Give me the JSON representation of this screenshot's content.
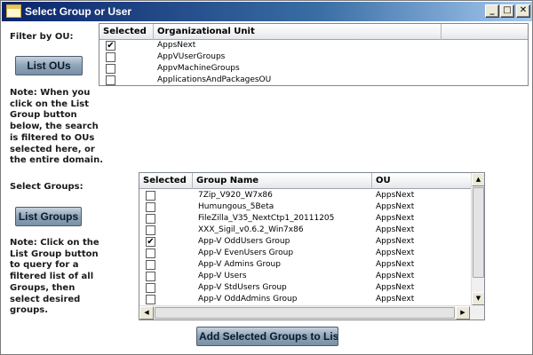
{
  "window": {
    "title": "Select Group or User",
    "minimize_glyph": "_",
    "maximize_glyph": "□",
    "close_glyph": "✕"
  },
  "filter": {
    "label": "Filter by OU:",
    "list_ous_button": "List OUs",
    "note_lines": [
      "Note: When you",
      "click on the List",
      "Group button",
      "below, the search",
      "is filtered to OUs",
      "selected here, or",
      "the entire domain."
    ]
  },
  "ou_grid": {
    "headers": [
      "Selected",
      "Organizational Unit",
      ""
    ],
    "rows": [
      {
        "selected": true,
        "name": "AppsNext"
      },
      {
        "selected": false,
        "name": "AppVUserGroups"
      },
      {
        "selected": false,
        "name": "AppvMachineGroups"
      },
      {
        "selected": false,
        "name": "ApplicationsAndPackagesOU"
      }
    ]
  },
  "groups": {
    "label": "Select Groups:",
    "list_groups_button": "List Groups",
    "note_lines": [
      "Note: Click on the",
      "List Group button",
      "to query for a",
      "filtered list of all",
      "Groups, then",
      "select desired",
      "groups."
    ]
  },
  "group_grid": {
    "headers": [
      "Selected",
      "Group Name",
      "OU"
    ],
    "rows": [
      {
        "selected": false,
        "name": "7Zip_V920_W7x86",
        "ou": "AppsNext"
      },
      {
        "selected": false,
        "name": "Humungous_5Beta",
        "ou": "AppsNext"
      },
      {
        "selected": false,
        "name": "FileZilla_V35_NextCtp1_20111205",
        "ou": "AppsNext"
      },
      {
        "selected": false,
        "name": "XXX_Sigil_v0.6.2_Win7x86",
        "ou": "AppsNext"
      },
      {
        "selected": true,
        "name": "App-V OddUsers Group",
        "ou": "AppsNext"
      },
      {
        "selected": false,
        "name": "App-V EvenUsers Group",
        "ou": "AppsNext"
      },
      {
        "selected": false,
        "name": "App-V Admins Group",
        "ou": "AppsNext"
      },
      {
        "selected": false,
        "name": "App-V Users",
        "ou": "AppsNext"
      },
      {
        "selected": false,
        "name": "App-V StdUsers Group",
        "ou": "AppsNext"
      },
      {
        "selected": false,
        "name": "App-V OddAdmins Group",
        "ou": "AppsNext"
      }
    ]
  },
  "add_button": "Add Selected Groups to List"
}
